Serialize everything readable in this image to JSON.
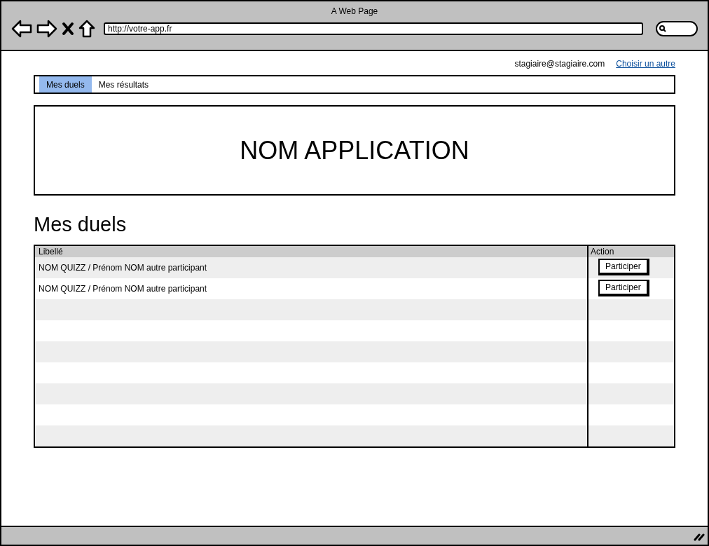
{
  "window": {
    "title": "A Web Page"
  },
  "address_bar": {
    "value": "http://votre-app.fr"
  },
  "user": {
    "email": "stagiaire@stagiaire.com",
    "switch_link": "Choisir un autre"
  },
  "tabs": [
    {
      "label": "Mes duels",
      "selected": true
    },
    {
      "label": "Mes résultats",
      "selected": false
    }
  ],
  "banner": {
    "title": "NOM APPLICATION"
  },
  "section_title": "Mes duels",
  "table": {
    "columns": [
      "Libellé",
      "Action"
    ],
    "rows": [
      {
        "label": "NOM QUIZZ / Prénom NOM autre participant",
        "action": "Participer"
      },
      {
        "label": "NOM QUIZZ / Prénom NOM autre participant",
        "action": "Participer"
      }
    ]
  }
}
